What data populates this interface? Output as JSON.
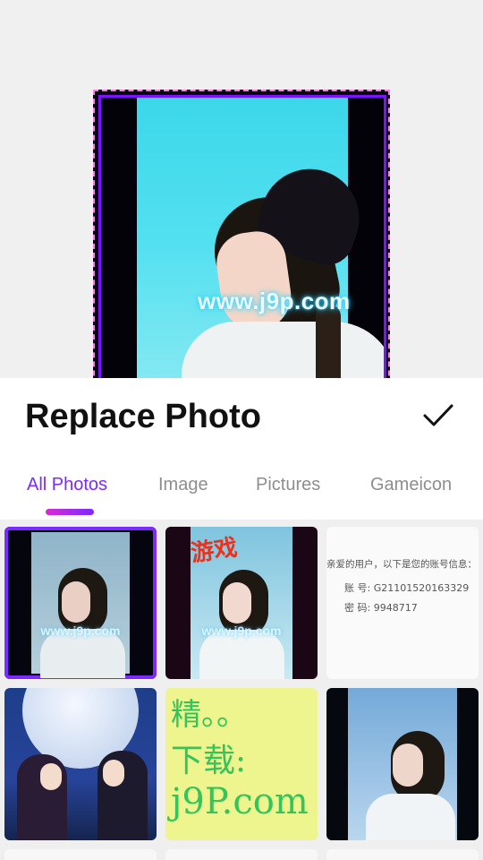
{
  "preview": {
    "watermark": "www.j9p.com"
  },
  "sheet": {
    "title": "Replace Photo",
    "confirm_icon": "checkmark-icon"
  },
  "tabs": [
    {
      "label": "All Photos",
      "active": true
    },
    {
      "label": "Image",
      "active": false
    },
    {
      "label": "Pictures",
      "active": false
    },
    {
      "label": "Gameicon",
      "active": false
    }
  ],
  "colors": {
    "accent": "#7b2bff",
    "accent_gradient_start": "#d82bd0",
    "tab_inactive": "#8e8e8e"
  },
  "photos": [
    {
      "watermark": "www.j9p.com",
      "selected": true
    },
    {
      "watermark": "www.j9p.com",
      "stamp": "游戏",
      "selected": false
    },
    {
      "lines": [
        "亲爱的用户，以下是您的账号信息：",
        "账  号:    G21101520163329",
        "密  码:    9948717"
      ],
      "selected": false
    },
    {
      "selected": false
    },
    {
      "lines": [
        "精。。",
        "下载:",
        "j9P.com"
      ],
      "selected": false
    },
    {
      "selected": false
    }
  ]
}
